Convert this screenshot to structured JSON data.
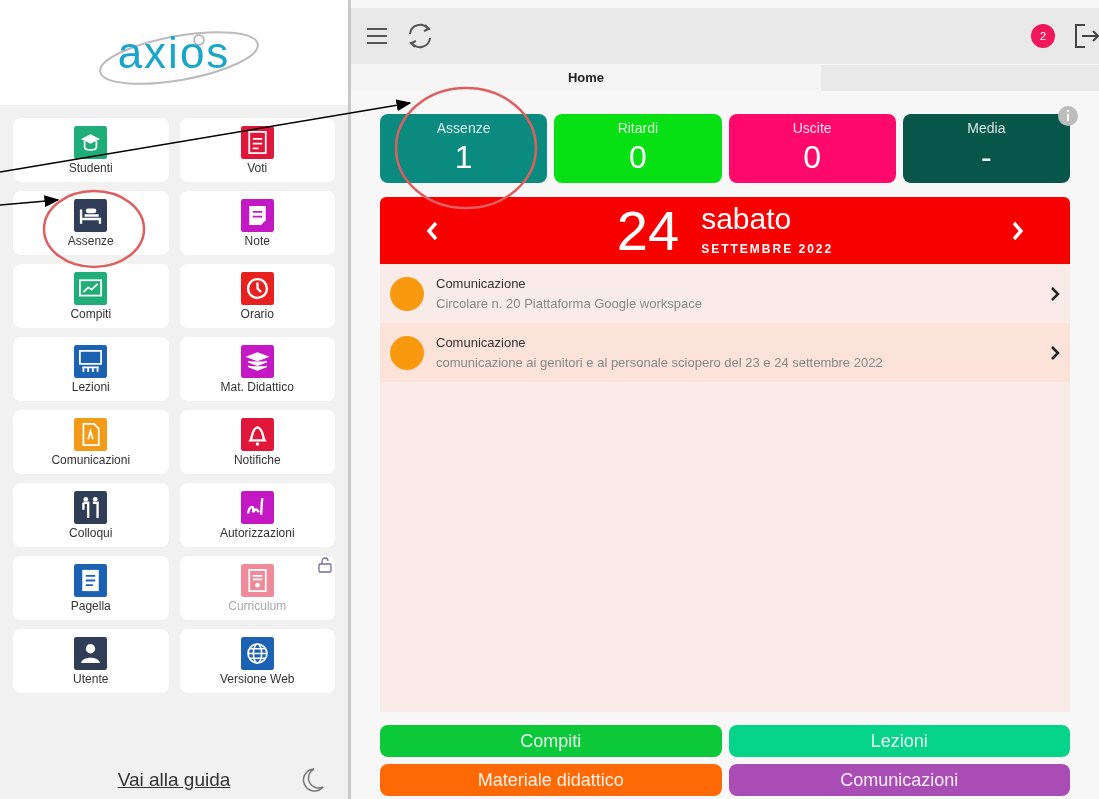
{
  "sidebar": {
    "logo": "axios",
    "tiles": [
      {
        "label": "Studenti",
        "color": "#1fae7a",
        "disabled": false,
        "locked": false
      },
      {
        "label": "Voti",
        "color": "#e0173a",
        "disabled": false,
        "locked": false
      },
      {
        "label": "Assenze",
        "color": "#2f3d57",
        "disabled": false,
        "locked": false
      },
      {
        "label": "Note",
        "color": "#c418c4",
        "disabled": false,
        "locked": false
      },
      {
        "label": "Compiti",
        "color": "#1fae7a",
        "disabled": false,
        "locked": false
      },
      {
        "label": "Orario",
        "color": "#e8201e",
        "disabled": false,
        "locked": false
      },
      {
        "label": "Lezioni",
        "color": "#1b62b3",
        "disabled": false,
        "locked": false
      },
      {
        "label": "Mat. Didattico",
        "color": "#c418c4",
        "disabled": false,
        "locked": false
      },
      {
        "label": "Comunicazioni",
        "color": "#f39a16",
        "disabled": false,
        "locked": false
      },
      {
        "label": "Notifiche",
        "color": "#e0173a",
        "disabled": false,
        "locked": false
      },
      {
        "label": "Colloqui",
        "color": "#2f3d57",
        "disabled": false,
        "locked": false
      },
      {
        "label": "Autorizzazioni",
        "color": "#c418c4",
        "disabled": false,
        "locked": false
      },
      {
        "label": "Pagella",
        "color": "#1b62b3",
        "disabled": false,
        "locked": false
      },
      {
        "label": "Curriculum",
        "color": "#f0899a",
        "disabled": true,
        "locked": true
      },
      {
        "label": "Utente",
        "color": "#2f3d57",
        "disabled": false,
        "locked": false
      },
      {
        "label": "Versione Web",
        "color": "#1b62b3",
        "disabled": false,
        "locked": false
      }
    ],
    "guide_link": "Vai alla guida"
  },
  "header": {
    "badge": "2"
  },
  "tabs": [
    {
      "label": "Home",
      "selected": true
    }
  ],
  "stats": [
    {
      "label": "Assenze",
      "value": "1",
      "color": "#0b8a80"
    },
    {
      "label": "Ritardi",
      "value": "0",
      "color": "#07e012"
    },
    {
      "label": "Uscite",
      "value": "0",
      "color": "#ff0a6c"
    },
    {
      "label": "Media",
      "value": "-",
      "color": "#07564a"
    }
  ],
  "date": {
    "day": "24",
    "weekday": "sabato",
    "month_year": "SETTEMBRE 2022"
  },
  "events": [
    {
      "title": "Comunicazione",
      "text": "Circolare n. 20 Piattaforma Google workspace",
      "color": "#f8990f"
    },
    {
      "title": "Comunicazione",
      "text": "comunicazione ai genitori e al personale sciopero del 23 e 24 settembre 2022",
      "color": "#f8990f"
    }
  ],
  "buttons": [
    {
      "label": "Compiti",
      "color": "#0cc93a"
    },
    {
      "label": "Lezioni",
      "color": "#06d38a"
    },
    {
      "label": "Materiale didattico",
      "color": "#ff6a06"
    },
    {
      "label": "Comunicazioni",
      "color": "#a94db5"
    }
  ]
}
